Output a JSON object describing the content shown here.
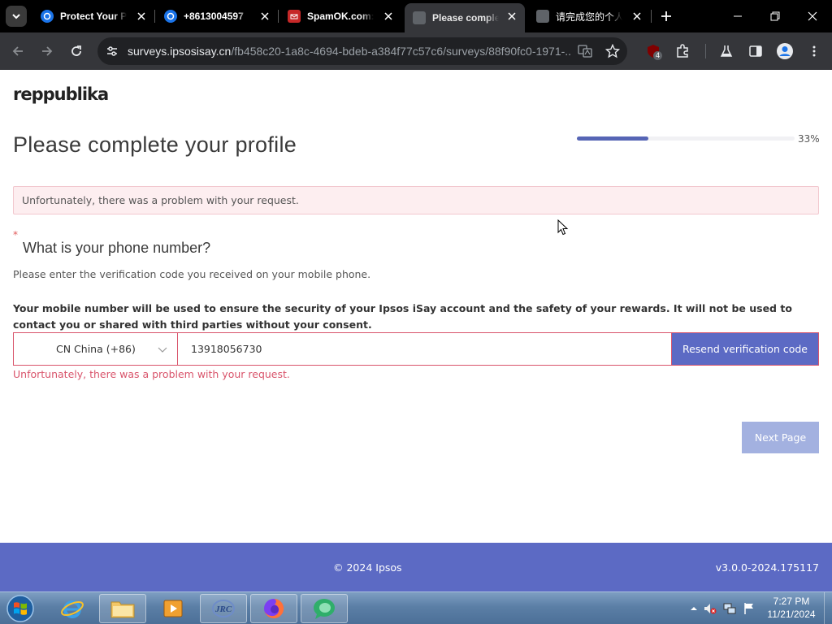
{
  "browser": {
    "tabs": [
      {
        "title": "Protect Your Pe",
        "favicon": "globe-blue",
        "active": false
      },
      {
        "title": "+8613004597",
        "favicon": "globe-blue",
        "active": false
      },
      {
        "title": "SpamOK.com:",
        "favicon": "spamok-red",
        "active": false
      },
      {
        "title": "Please complete",
        "favicon": "doc-gray",
        "active": true
      },
      {
        "title": "请完成您的个人",
        "favicon": "doc-gray",
        "active": false
      }
    ],
    "url_host": "surveys.ipsosisay.cn",
    "url_path": "/fb458c20-1a8c-4694-bdeb-a384f77c57c6/surveys/88f90fc0-1971-...",
    "extension_badge": "4"
  },
  "page": {
    "logo_text": "reppublika",
    "title": "Please complete your profile",
    "progress_percent": 33,
    "progress_label": "33%",
    "alert_text": "Unfortunately, there was a problem with your request.",
    "required_marker": "*",
    "question": "What is your phone number?",
    "instruction": "Please enter the verification code you received on your mobile phone.",
    "notice": "Your mobile number will be used to ensure the security of your Ipsos iSay account and the safety of your rewards. It will not be used to contact you or shared with third parties without your consent.",
    "country_selected": "CN China (+86)",
    "phone_value": "13918056730",
    "resend_label": "Resend verification code",
    "field_error": "Unfortunately, there was a problem with your request.",
    "next_label": "Next Page",
    "footer_copyright": "© 2024 Ipsos",
    "footer_version": "v3.0.0-2024.175117"
  },
  "colors": {
    "primary": "#5c6ac4",
    "error": "#d9546b",
    "alert_bg": "#fdeef0",
    "next_disabled": "#a3b1e0"
  },
  "taskbar": {
    "apps": [
      "internet-explorer",
      "file-explorer",
      "media-player",
      "jrc-app",
      "firefox",
      "chat-app"
    ],
    "time": "7:27 PM",
    "date": "11/21/2024"
  }
}
